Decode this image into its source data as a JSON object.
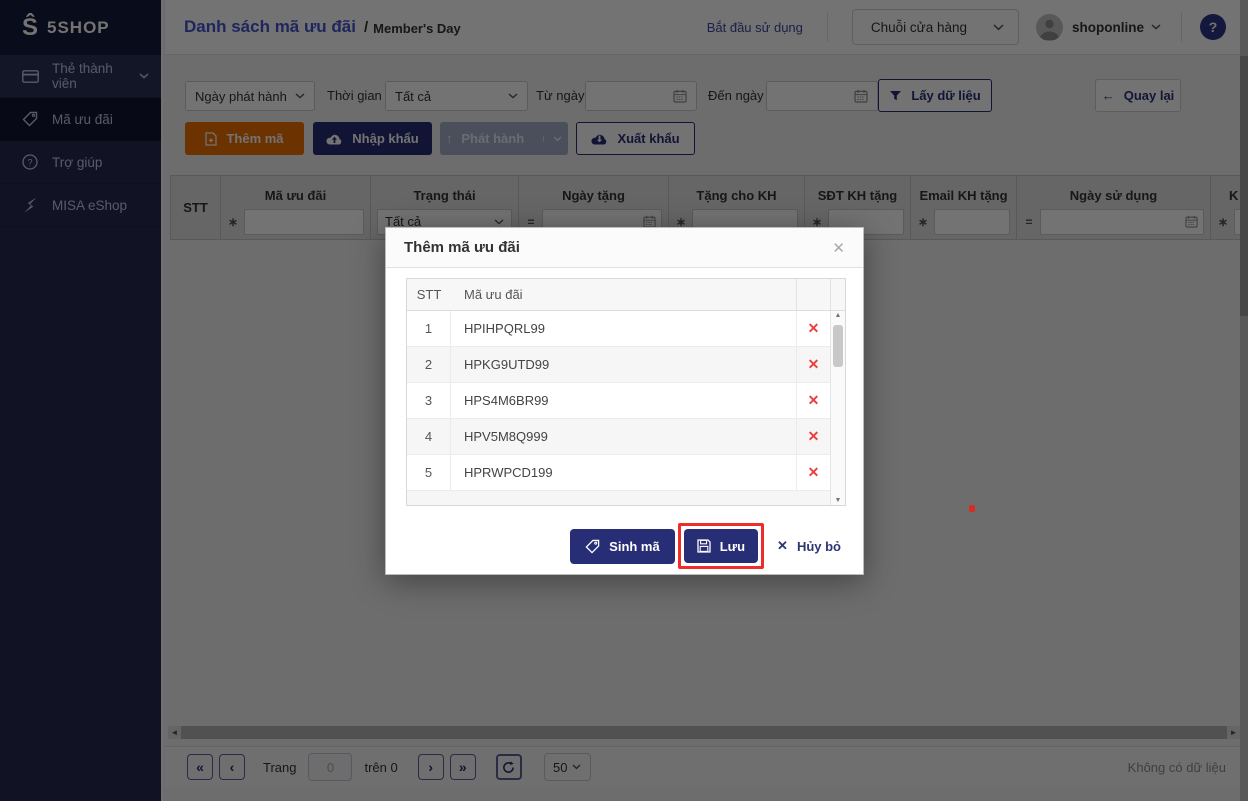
{
  "app": {
    "logo_mark": "Ŝ",
    "logo_text": "5SHOP"
  },
  "sidebar": {
    "items": [
      {
        "label": "Thẻ thành viên"
      },
      {
        "label": "Mã ưu đãi"
      },
      {
        "label": "Trợ giúp"
      },
      {
        "label": "MISA eShop"
      }
    ]
  },
  "header": {
    "title": "Danh sách mã ưu đãi",
    "separator": "/",
    "subtitle": "Member's Day",
    "start_label": "Bắt đầu sử dụng",
    "store_label": "Chuỗi cửa hàng",
    "user_name": "shoponline",
    "help_glyph": "?"
  },
  "filters": {
    "field_value": "Ngày phát hành",
    "time_label": "Thời gian",
    "time_value": "Tất cả",
    "from_label": "Từ ngày",
    "to_label": "Đến ngày",
    "fetch_label": "Lấy dữ liệu",
    "back_label": "Quay lại",
    "back_arrow": "←"
  },
  "actions": {
    "add_label": "Thêm mã",
    "import_label": "Nhập khẩu",
    "issue_label": "Phát hành",
    "issue_arrow": "↑",
    "export_label": "Xuất khẩu"
  },
  "grid": {
    "columns": [
      {
        "label": "STT"
      },
      {
        "label": "Mã ưu đãi",
        "op": "∗"
      },
      {
        "label": "Trạng thái",
        "filter_value": "Tất cả"
      },
      {
        "label": "Ngày tặng",
        "op": "="
      },
      {
        "label": "Tặng cho KH",
        "op": "∗"
      },
      {
        "label": "SĐT KH tặng",
        "op": "∗"
      },
      {
        "label": "Email KH tặng",
        "op": "∗"
      },
      {
        "label": "Ngày sử dụng",
        "op": "="
      },
      {
        "label": "K",
        "op": "∗"
      }
    ]
  },
  "modal": {
    "title": "Thêm mã ưu đãi",
    "close_glyph": "✕",
    "col_stt": "STT",
    "col_code": "Mã ưu đãi",
    "delete_glyph": "✕",
    "rows": [
      {
        "stt": "1",
        "code": "HPIHPQRL99"
      },
      {
        "stt": "2",
        "code": "HPKG9UTD99"
      },
      {
        "stt": "3",
        "code": "HPS4M6BR99"
      },
      {
        "stt": "4",
        "code": "HPV5M8Q999"
      },
      {
        "stt": "5",
        "code": "HPRWPCD199"
      }
    ],
    "generate_label": "Sinh mã",
    "save_label": "Lưu",
    "cancel_label": "Hủy bỏ",
    "cancel_glyph": "✕"
  },
  "pagination": {
    "first_glyph": "«",
    "prev_glyph": "‹",
    "page_label": "Trang",
    "page_value": "0",
    "of_label": "trên 0",
    "next_glyph": "›",
    "last_glyph": "»",
    "page_size": "50",
    "empty_text": "Không có dữ liệu"
  },
  "glyphs": {
    "up": "▲",
    "down": "▼",
    "left": "◄",
    "right": "►"
  },
  "colors": {
    "accent_orange": "#ef7100",
    "primary_navy": "#272e75",
    "title_blue": "#4656cf",
    "delete_red": "#e84040",
    "annotation_red": "#ee2d2a"
  }
}
